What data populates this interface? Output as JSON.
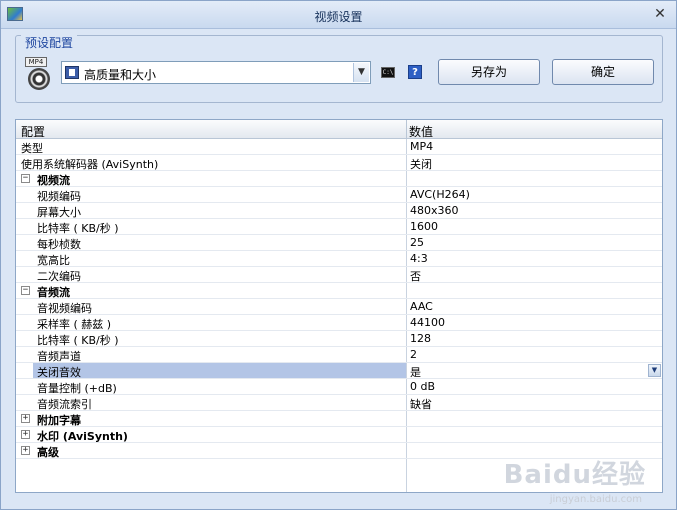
{
  "window": {
    "title": "视频设置"
  },
  "preset": {
    "legend": "预设配置",
    "selected": "高质量和大小",
    "icon_badge": "MP4",
    "save_as_label": "另存为",
    "ok_label": "确定",
    "help_label": "?",
    "cmd_label": "C:\\"
  },
  "grid": {
    "col_name": "配置",
    "col_value": "数值",
    "rows": [
      {
        "name": "类型",
        "value": "MP4"
      },
      {
        "name": "使用系统解码器 (AviSynth)",
        "value": "关闭"
      },
      {
        "name": "视频流",
        "value": "",
        "group": true,
        "toggle": "−"
      },
      {
        "name": "视频编码",
        "value": "AVC(H264)"
      },
      {
        "name": "屏幕大小",
        "value": "480x360"
      },
      {
        "name": "比特率 ( KB/秒 )",
        "value": "1600"
      },
      {
        "name": "每秒桢数",
        "value": "25"
      },
      {
        "name": "宽高比",
        "value": "4:3"
      },
      {
        "name": "二次编码",
        "value": "否"
      },
      {
        "name": "音频流",
        "value": "",
        "group": true,
        "toggle": "−"
      },
      {
        "name": "音视频编码",
        "value": "AAC"
      },
      {
        "name": "采样率 ( 赫兹 )",
        "value": "44100"
      },
      {
        "name": "比特率 ( KB/秒 )",
        "value": "128"
      },
      {
        "name": "音频声道",
        "value": "2"
      },
      {
        "name": "关闭音效",
        "value": "是"
      },
      {
        "name": "音量控制 (+dB)",
        "value": "0 dB"
      },
      {
        "name": "音频流索引",
        "value": "缺省"
      },
      {
        "name": "附加字幕",
        "value": "",
        "group": true,
        "toggle": "+"
      },
      {
        "name": "水印 (AviSynth)",
        "value": "",
        "group": true,
        "toggle": "+"
      },
      {
        "name": "高级",
        "value": "",
        "group": true,
        "toggle": "+"
      }
    ]
  },
  "watermark": {
    "text": "Baidu经验",
    "sub": "jingyan.baidu.com"
  }
}
